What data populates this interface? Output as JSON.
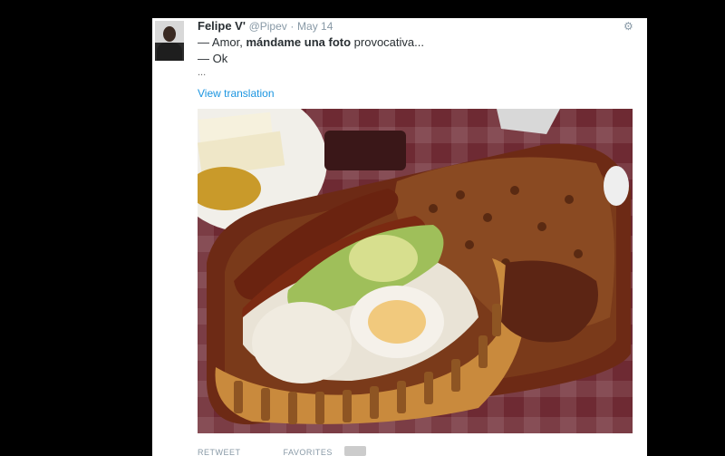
{
  "tweet": {
    "author_name": "Felipe V'",
    "handle": "@Pipev",
    "separator": "·",
    "date": "May 14",
    "line1_prefix": "— Amor, ",
    "line1_bold": "mándame una foto",
    "line1_suffix": " provocativa...",
    "line2": "— Ok",
    "ellipsis": "...",
    "translate_link": "View translation",
    "corner_icon": "dropdown-caret-icon"
  },
  "actions": {
    "retweets_label": "RETWEET",
    "favorites_label": "FAVORITES"
  },
  "colors": {
    "background": "#000000",
    "card": "#ffffff",
    "text": "#292f33",
    "muted": "#8899a6",
    "link": "#1b95e0"
  }
}
